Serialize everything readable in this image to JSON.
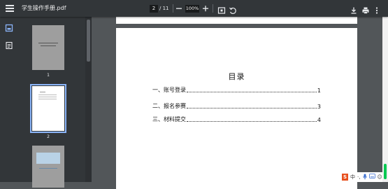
{
  "toolbar": {
    "title": "学生操作手册.pdf",
    "current_page": "2",
    "page_separator": "/ 11",
    "zoom": "100%"
  },
  "sidebar": {
    "thumbnails": [
      {
        "label": "1"
      },
      {
        "label": "2"
      },
      {
        "label": ""
      }
    ]
  },
  "document": {
    "toc_title": "目录",
    "entries": [
      {
        "label": "一、账号登录",
        "page": "1"
      },
      {
        "label": "二、报名参赛",
        "page": "3"
      },
      {
        "label": "三、材料提交",
        "page": "4"
      }
    ]
  },
  "tray": {
    "ime_logo": "S",
    "ime_lang": "中",
    "punct": "·,",
    "emoji": "☺"
  },
  "colors": {
    "toolbar_bg": "#323639",
    "viewer_bg": "#525659",
    "selected_thumb_border": "#8ab4f8",
    "ime_accent": "#e8501e"
  }
}
